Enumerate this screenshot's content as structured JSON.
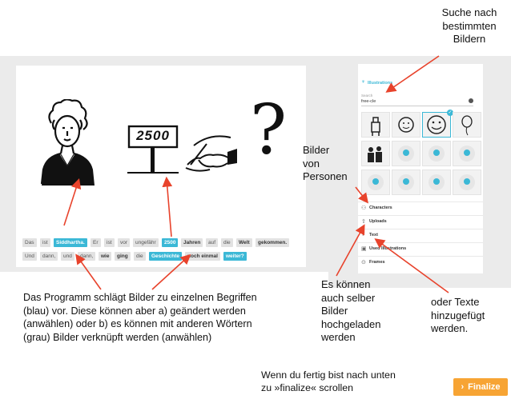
{
  "annotations": {
    "search_note": [
      "Suche nach",
      "bestimmten",
      "Bildern"
    ],
    "persons_note": [
      "Bilder",
      "von",
      "Personen"
    ],
    "upload_note": [
      "Es können",
      "auch selber",
      "Bilder",
      "hochgeladen",
      "werden"
    ],
    "text_note": [
      "oder Texte",
      "hinzugefügt",
      "werden."
    ],
    "program_note": [
      "Das Programm schlägt Bilder zu einzelnen Begriffen",
      "(blau) vor. Diese können aber a) geändert werden",
      "(anwählen) oder b) es können mit anderen Wörtern",
      "(grau) Bilder verknüpft werden (anwählen)"
    ],
    "finalize_note": [
      "Wenn du fertig bist nach unten",
      "zu »finalize« scrollen"
    ]
  },
  "canvas": {
    "sign_number": "2500",
    "sentence_row1": [
      {
        "text": "Das",
        "style": "plain"
      },
      {
        "text": "ist",
        "style": "plain"
      },
      {
        "text": "Siddhartha.",
        "style": "blue"
      },
      {
        "text": "Er",
        "style": "plain"
      },
      {
        "text": "ist",
        "style": "plain"
      },
      {
        "text": "vor",
        "style": "plain"
      },
      {
        "text": "ungefähr",
        "style": "plain"
      },
      {
        "text": "2500",
        "style": "blue"
      },
      {
        "text": "Jahren",
        "style": "bold"
      },
      {
        "text": "auf",
        "style": "plain"
      },
      {
        "text": "die",
        "style": "plain"
      },
      {
        "text": "Welt",
        "style": "bold"
      },
      {
        "text": "gekommen.",
        "style": "bold"
      }
    ],
    "sentence_row2": [
      {
        "text": "Und",
        "style": "plain"
      },
      {
        "text": "dann,",
        "style": "plain"
      },
      {
        "text": "und",
        "style": "plain"
      },
      {
        "text": "dann,",
        "style": "plain"
      },
      {
        "text": "wie",
        "style": "bold"
      },
      {
        "text": "ging",
        "style": "bold"
      },
      {
        "text": "die",
        "style": "plain"
      },
      {
        "text": "Geschichte",
        "style": "blue"
      },
      {
        "text": "noch einmal",
        "style": "bold"
      },
      {
        "text": "weiter?",
        "style": "blue"
      }
    ]
  },
  "panel": {
    "header": "Illustrations",
    "search_label": "Search",
    "search_value": "free-cle",
    "list": [
      {
        "label": "Characters",
        "icon": "person-icon"
      },
      {
        "label": "Uploads",
        "icon": "upload-icon"
      },
      {
        "label": "Text",
        "icon": "text-icon"
      },
      {
        "label": "Used Illustrations",
        "icon": "image-icon"
      },
      {
        "label": "Frames",
        "icon": "frame-icon"
      }
    ]
  },
  "finalize": {
    "label": "Finalize",
    "icon": "chevron-right-icon"
  },
  "colors": {
    "accent_blue": "#3bb8d6",
    "finalize_orange": "#f7a434",
    "arrow_red": "#e8432c"
  }
}
